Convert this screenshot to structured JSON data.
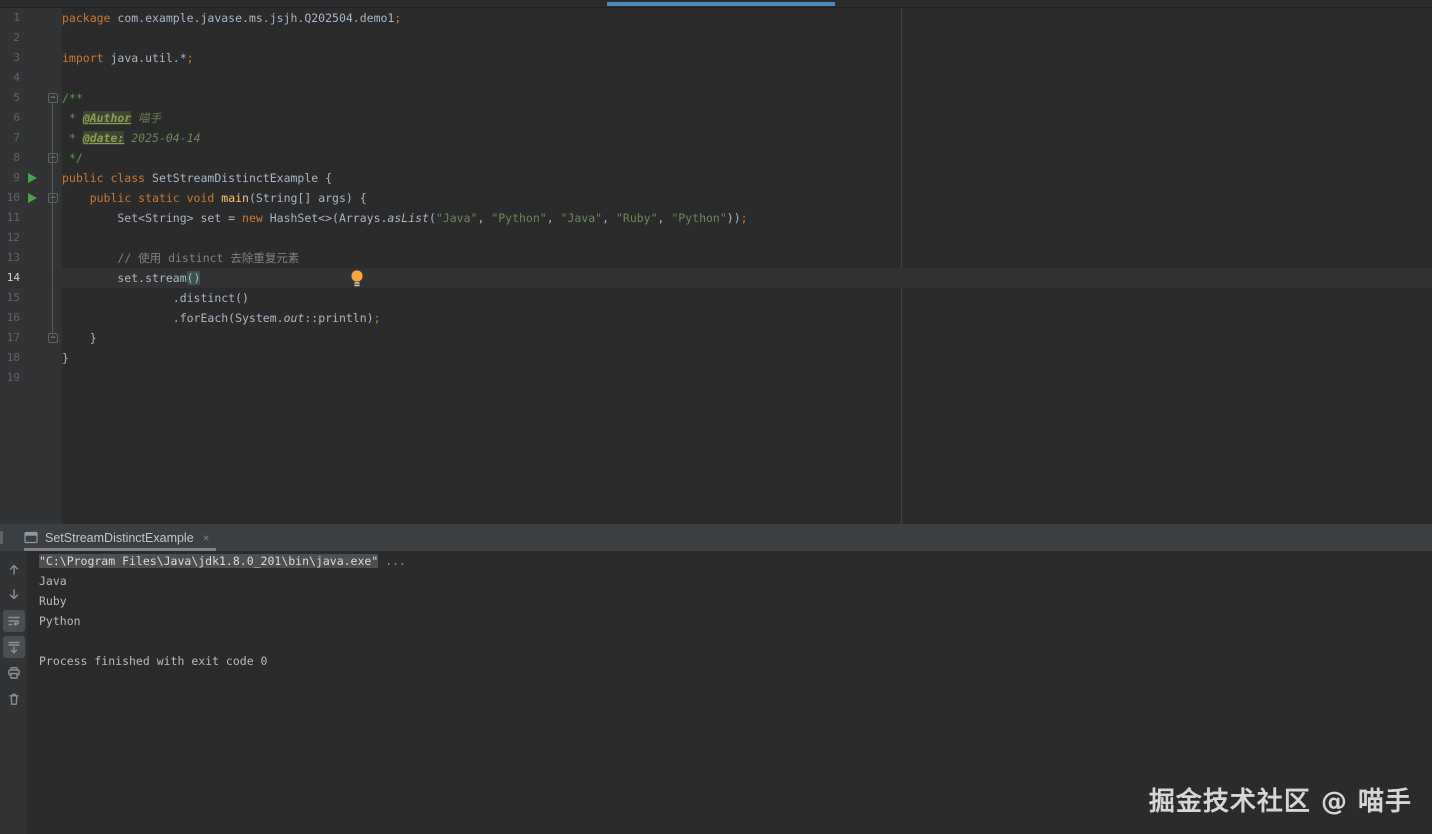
{
  "colors": {
    "editor_bg": "#2b2b2b",
    "gutter_bg": "#313335",
    "caret_line_bg": "#323232",
    "keyword": "#CC7832",
    "string": "#6A8759",
    "comment": "#808080",
    "doc_comment": "#629755",
    "method_decl": "#FFC66D",
    "plain": "#A9B7C6",
    "run_icon_green": "#4ea24e",
    "tab_indicator_blue": "#4e86bc",
    "console_header_bg": "#3c3f41",
    "bulb_yellow": "#f2a63c"
  },
  "top_indicator": {
    "name": "active-file-tab-underline"
  },
  "editor": {
    "lines": [
      {
        "n": "1",
        "tokens": [
          [
            "kw",
            "package"
          ],
          [
            "pl",
            " com.example.javase.ms.jsjh.Q202504.demo1"
          ],
          [
            "sem",
            ";"
          ]
        ]
      },
      {
        "n": "2",
        "tokens": []
      },
      {
        "n": "3",
        "tokens": [
          [
            "kw",
            "import"
          ],
          [
            "pl",
            " java.util.*"
          ],
          [
            "sem",
            ";"
          ]
        ]
      },
      {
        "n": "4",
        "tokens": []
      },
      {
        "n": "5",
        "fold": "start",
        "tokens": [
          [
            "doc",
            "/**"
          ]
        ]
      },
      {
        "n": "6",
        "tokens": [
          [
            "doc",
            " * "
          ],
          [
            "tag",
            "@Author"
          ],
          [
            "tagv",
            " 喵手"
          ]
        ]
      },
      {
        "n": "7",
        "tokens": [
          [
            "doc",
            " * "
          ],
          [
            "tag",
            "@date:"
          ],
          [
            "docv",
            " 2025-04-14"
          ]
        ]
      },
      {
        "n": "8",
        "fold": "end",
        "tokens": [
          [
            "doc",
            " */"
          ]
        ]
      },
      {
        "n": "9",
        "run": true,
        "tokens": [
          [
            "kw",
            "public class"
          ],
          [
            "pl",
            " SetStreamDistinctExample {"
          ]
        ]
      },
      {
        "n": "10",
        "run": true,
        "fold": "start",
        "tokens": [
          [
            "pl",
            "    "
          ],
          [
            "kw",
            "public static void"
          ],
          [
            "pl",
            " "
          ],
          [
            "decl",
            "main"
          ],
          [
            "pl",
            "(String[] args) {"
          ]
        ]
      },
      {
        "n": "11",
        "tokens": [
          [
            "pl",
            "        Set<String> set = "
          ],
          [
            "kw",
            "new"
          ],
          [
            "pl",
            " HashSet<>(Arrays."
          ],
          [
            "smeth",
            "asList"
          ],
          [
            "pl",
            "("
          ],
          [
            "str",
            "\"Java\""
          ],
          [
            "pl",
            ", "
          ],
          [
            "str",
            "\"Python\""
          ],
          [
            "pl",
            ", "
          ],
          [
            "str",
            "\"Java\""
          ],
          [
            "pl",
            ", "
          ],
          [
            "str",
            "\"Ruby\""
          ],
          [
            "pl",
            ", "
          ],
          [
            "str",
            "\"Python\""
          ],
          [
            "pl",
            "))"
          ],
          [
            "sem",
            ";"
          ]
        ]
      },
      {
        "n": "12",
        "tokens": []
      },
      {
        "n": "13",
        "tokens": [
          [
            "pl",
            "        "
          ],
          [
            "cmt",
            "// 使用 distinct 去除重复元素"
          ]
        ]
      },
      {
        "n": "14",
        "caret": true,
        "bulb": true,
        "tokens": [
          [
            "pl",
            "        set.stream"
          ],
          [
            "phl",
            "()"
          ]
        ]
      },
      {
        "n": "15",
        "tokens": [
          [
            "pl",
            "                .distinct()"
          ]
        ]
      },
      {
        "n": "16",
        "tokens": [
          [
            "pl",
            "                .forEach(System."
          ],
          [
            "sfield",
            "out"
          ],
          [
            "pl",
            "::println)"
          ],
          [
            "sem",
            ";"
          ]
        ]
      },
      {
        "n": "17",
        "fold": "end",
        "tokens": [
          [
            "pl",
            "    }"
          ]
        ]
      },
      {
        "n": "18",
        "tokens": [
          [
            "pl",
            "}"
          ]
        ]
      },
      {
        "n": "19",
        "tokens": []
      }
    ]
  },
  "console": {
    "tab": {
      "label": "SetStreamDistinctExample",
      "close": "×",
      "icon": "console-icon"
    },
    "toolbar": [
      {
        "name": "up-arrow",
        "active": false
      },
      {
        "name": "down-arrow",
        "active": false
      },
      {
        "name": "soft-wrap",
        "active": true
      },
      {
        "name": "scroll-to-end",
        "active": true
      },
      {
        "name": "print",
        "active": false
      },
      {
        "name": "clear",
        "active": false
      }
    ],
    "output": [
      {
        "text": "\"C:\\Program Files\\Java\\jdk1.8.0_201\\bin\\java.exe\"",
        "selected": true,
        "suffix": " ..."
      },
      {
        "text": "Java"
      },
      {
        "text": "Ruby"
      },
      {
        "text": "Python"
      },
      {
        "text": ""
      },
      {
        "text": "Process finished with exit code 0"
      }
    ]
  },
  "watermark": {
    "text": "掘金技术社区 @ 喵手"
  }
}
